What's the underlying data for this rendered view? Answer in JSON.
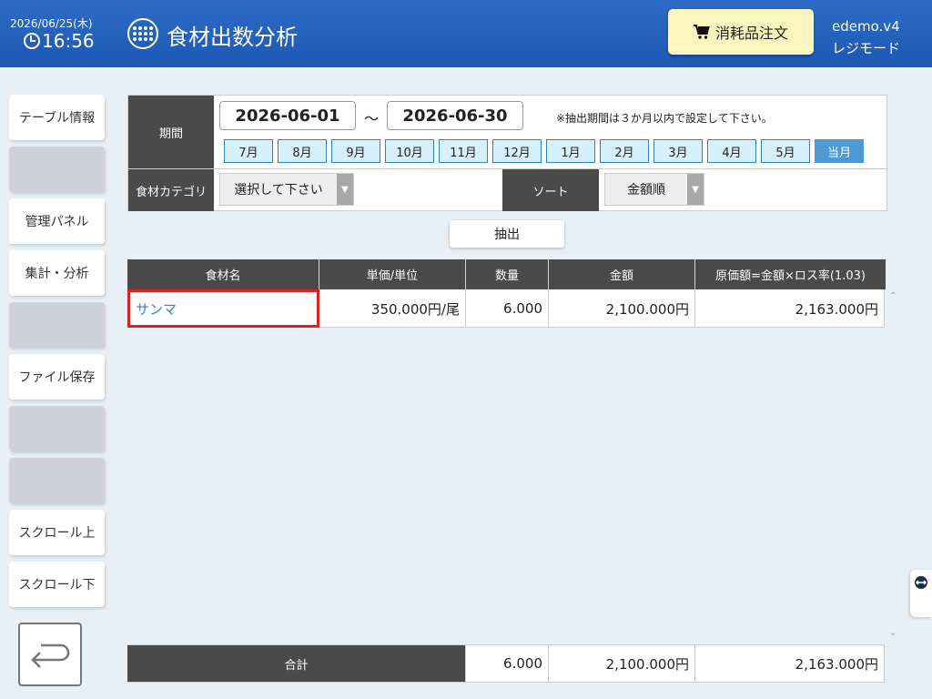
{
  "header": {
    "date": "2026/06/25(木)",
    "time": "16:56",
    "title": "食材出数分析",
    "order_button": "消耗品注文",
    "user": "edemo.v4",
    "mode": "レジモード"
  },
  "sidebar": {
    "items": [
      {
        "label": "テーブル情報"
      },
      {
        "label": ""
      },
      {
        "label": "管理パネル"
      },
      {
        "label": "集計・分析"
      },
      {
        "label": ""
      },
      {
        "label": "ファイル保存"
      },
      {
        "label": ""
      },
      {
        "label": ""
      },
      {
        "label": "スクロール上"
      },
      {
        "label": "スクロール下"
      }
    ]
  },
  "filter": {
    "period_label": "期間",
    "start_date": "2026-06-01",
    "separator": "～",
    "end_date": "2026-06-30",
    "note": "※抽出期間は３か月以内で設定して下さい。",
    "months": [
      "7月",
      "8月",
      "9月",
      "10月",
      "11月",
      "12月",
      "1月",
      "2月",
      "3月",
      "4月",
      "5月",
      "当月"
    ],
    "active_month": "当月",
    "category_label": "食材カテゴリ",
    "category_value": "選択して下さい",
    "sort_label": "ソート",
    "sort_value": "金額順",
    "extract_button": "抽出"
  },
  "table": {
    "headers": [
      "食材名",
      "単価/単位",
      "数量",
      "金額",
      "原価額=金額×ロス率(1.03)"
    ],
    "rows": [
      {
        "name": "サンマ",
        "unit_price": "350.000円/尾",
        "quantity": "6.000",
        "amount": "2,100.000円",
        "cost": "2,163.000円"
      }
    ],
    "footer": {
      "label": "合計",
      "quantity": "6.000",
      "amount": "2,100.000円",
      "cost": "2,163.000円"
    }
  },
  "colors": {
    "header_bg": "#1c59b3",
    "accent": "#2a86c6",
    "highlight": "#e02020",
    "order_button_bg": "#fdf5c0"
  }
}
